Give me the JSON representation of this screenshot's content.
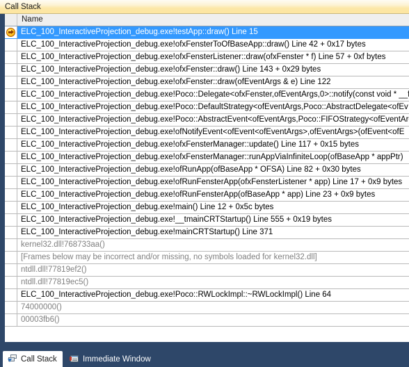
{
  "window": {
    "title": "Call Stack"
  },
  "grid": {
    "columns": [
      "Name"
    ],
    "rows": [
      {
        "marker": "current-statement-arrow",
        "dim": false,
        "selected": true,
        "name": "ELC_100_InteractiveProjection_debug.exe!testApp::draw()  Line 15"
      },
      {
        "marker": "",
        "dim": false,
        "selected": false,
        "name": "ELC_100_InteractiveProjection_debug.exe!ofxFensterToOfBaseApp::draw()  Line 42 + 0x17 bytes"
      },
      {
        "marker": "",
        "dim": false,
        "selected": false,
        "name": "ELC_100_InteractiveProjection_debug.exe!ofxFensterListener::draw(ofxFenster * f)  Line 57 + 0xf bytes"
      },
      {
        "marker": "",
        "dim": false,
        "selected": false,
        "name": "ELC_100_InteractiveProjection_debug.exe!ofxFenster::draw()  Line 143 + 0x29 bytes"
      },
      {
        "marker": "",
        "dim": false,
        "selected": false,
        "name": "ELC_100_InteractiveProjection_debug.exe!ofxFenster::draw(ofEventArgs & e)  Line 122"
      },
      {
        "marker": "",
        "dim": false,
        "selected": false,
        "name": "ELC_100_InteractiveProjection_debug.exe!Poco::Delegate<ofxFenster,ofEventArgs,0>::notify(const void * __f"
      },
      {
        "marker": "",
        "dim": false,
        "selected": false,
        "name": "ELC_100_InteractiveProjection_debug.exe!Poco::DefaultStrategy<ofEventArgs,Poco::AbstractDelegate<ofEv"
      },
      {
        "marker": "",
        "dim": false,
        "selected": false,
        "name": "ELC_100_InteractiveProjection_debug.exe!Poco::AbstractEvent<ofEventArgs,Poco::FIFOStrategy<ofEventArg"
      },
      {
        "marker": "",
        "dim": false,
        "selected": false,
        "name": "ELC_100_InteractiveProjection_debug.exe!ofNotifyEvent<ofEvent<ofEventArgs>,ofEventArgs>(ofEvent<ofE"
      },
      {
        "marker": "",
        "dim": false,
        "selected": false,
        "name": "ELC_100_InteractiveProjection_debug.exe!ofxFensterManager::update()  Line 117 + 0x15 bytes"
      },
      {
        "marker": "",
        "dim": false,
        "selected": false,
        "name": "ELC_100_InteractiveProjection_debug.exe!ofxFensterManager::runAppViaInfiniteLoop(ofBaseApp * appPtr)"
      },
      {
        "marker": "",
        "dim": false,
        "selected": false,
        "name": "ELC_100_InteractiveProjection_debug.exe!ofRunApp(ofBaseApp * OFSA)  Line 82 + 0x30 bytes"
      },
      {
        "marker": "",
        "dim": false,
        "selected": false,
        "name": "ELC_100_InteractiveProjection_debug.exe!ofRunFensterApp(ofxFensterListener * app)  Line 17 + 0x9 bytes"
      },
      {
        "marker": "",
        "dim": false,
        "selected": false,
        "name": "ELC_100_InteractiveProjection_debug.exe!ofRunFensterApp(ofBaseApp * app)  Line 23 + 0x9 bytes"
      },
      {
        "marker": "",
        "dim": false,
        "selected": false,
        "name": "ELC_100_InteractiveProjection_debug.exe!main()  Line 12 + 0x5c bytes"
      },
      {
        "marker": "",
        "dim": false,
        "selected": false,
        "name": "ELC_100_InteractiveProjection_debug.exe!__tmainCRTStartup()  Line 555 + 0x19 bytes"
      },
      {
        "marker": "",
        "dim": false,
        "selected": false,
        "name": "ELC_100_InteractiveProjection_debug.exe!mainCRTStartup()  Line 371"
      },
      {
        "marker": "",
        "dim": true,
        "selected": false,
        "name": "kernel32.dll!768733aa()"
      },
      {
        "marker": "",
        "dim": true,
        "selected": false,
        "name": "[Frames below may be incorrect and/or missing, no symbols loaded for kernel32.dll]"
      },
      {
        "marker": "",
        "dim": true,
        "selected": false,
        "name": "ntdll.dll!77819ef2()"
      },
      {
        "marker": "",
        "dim": true,
        "selected": false,
        "name": "ntdll.dll!77819ec5()"
      },
      {
        "marker": "",
        "dim": false,
        "selected": false,
        "name": "ELC_100_InteractiveProjection_debug.exe!Poco::RWLockImpl::~RWLockImpl()  Line 64"
      },
      {
        "marker": "",
        "dim": true,
        "selected": false,
        "name": "74000000()"
      },
      {
        "marker": "",
        "dim": true,
        "selected": false,
        "name": "00003fb6()"
      }
    ]
  },
  "tabs": [
    {
      "label": "Call Stack",
      "icon": "call-stack-icon",
      "active": true
    },
    {
      "label": "Immediate Window",
      "icon": "immediate-window-icon",
      "active": false
    }
  ],
  "colors": {
    "selection": "#3399ff",
    "title_gradient_top": "#fefcf4",
    "title_gradient_bottom": "#fde6a0",
    "chrome": "#2e4769",
    "dim_text": "#808080"
  }
}
